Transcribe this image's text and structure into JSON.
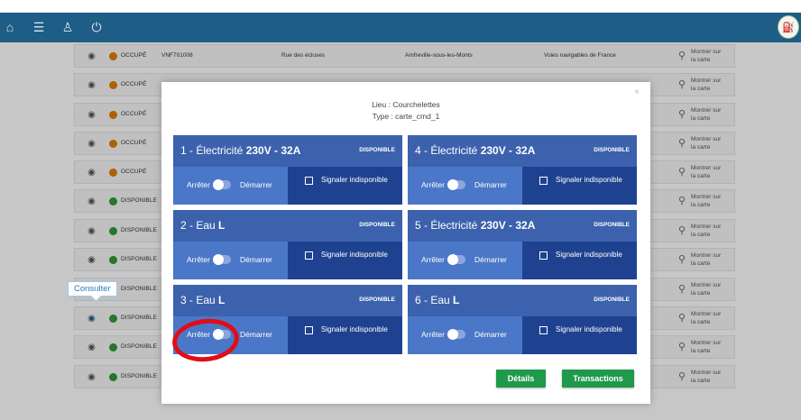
{
  "topbar": {
    "icons": [
      "home-icon",
      "menu-icon",
      "user-icon",
      "power-icon"
    ],
    "logo_icon": "station-logo"
  },
  "background_rows": [
    {
      "status": "OCCUPÉ",
      "status_color": "#e07b00",
      "c1": "VNF701008",
      "c2": "Rue des écluses",
      "c3": "Amfreville-sous-les-Monts",
      "c4": "Voies navigables de France",
      "map": "Montrer sur la carte"
    },
    {
      "status": "OCCUPÉ",
      "status_color": "#e07b00",
      "c1": "",
      "c2": "",
      "c3": "",
      "c4": "",
      "map": "Montrer sur la carte"
    },
    {
      "status": "OCCUPÉ",
      "status_color": "#e07b00",
      "c1": "",
      "c2": "",
      "c3": "",
      "c4": "",
      "map": "Montrer sur la carte"
    },
    {
      "status": "OCCUPÉ",
      "status_color": "#e07b00",
      "c1": "",
      "c2": "",
      "c3": "",
      "c4": "",
      "map": "Montrer sur la carte"
    },
    {
      "status": "OCCUPÉ",
      "status_color": "#e07b00",
      "c1": "",
      "c2": "",
      "c3": "",
      "c4": "",
      "map": "Montrer sur la carte"
    },
    {
      "status": "DISPONIBLE",
      "status_color": "#2e9a3a",
      "c1": "",
      "c2": "",
      "c3": "",
      "c4": "",
      "map": "Montrer sur la carte"
    },
    {
      "status": "DISPONIBLE",
      "status_color": "#2e9a3a",
      "c1": "",
      "c2": "",
      "c3": "",
      "c4": "",
      "map": "Montrer sur la carte"
    },
    {
      "status": "DISPONIBLE",
      "status_color": "#2e9a3a",
      "c1": "",
      "c2": "",
      "c3": "",
      "c4": "",
      "map": "Montrer sur la carte"
    },
    {
      "status": "DISPONIBLE",
      "status_color": "#2e9a3a",
      "c1": "",
      "c2": "",
      "c3": "",
      "c4": "",
      "map": "Montrer sur la carte"
    },
    {
      "status": "DISPONIBLE",
      "status_color": "#2e9a3a",
      "c1": "",
      "c2": "",
      "c3": "",
      "c4": "",
      "map": "Montrer sur la carte"
    },
    {
      "status": "DISPONIBLE",
      "status_color": "#2e9a3a",
      "c1": "",
      "c2": "",
      "c3": "",
      "c4": "",
      "map": "Montrer sur la carte"
    },
    {
      "status": "DISPONIBLE",
      "status_color": "#2e9a3a",
      "c1": "",
      "c2": "",
      "c3": "",
      "c4": "",
      "map": "Montrer sur la carte"
    }
  ],
  "tooltip": "Consulter",
  "modal": {
    "close": "×",
    "lieu": "Lieu : Courchelettes",
    "type": "Type : carte_cmd_1",
    "cards": [
      {
        "prefix": "1 - Électricité ",
        "spec": "230V - 32A",
        "badge": "DISPONIBLE",
        "stop": "Arrêter",
        "start": "Démarrer",
        "report": "Signaler indisponible"
      },
      {
        "prefix": "4 - Électricité ",
        "spec": "230V - 32A",
        "badge": "DISPONIBLE",
        "stop": "Arrêter",
        "start": "Démarrer",
        "report": "Signaler indisponible"
      },
      {
        "prefix": "2 - Eau ",
        "spec": "L",
        "badge": "DISPONIBLE",
        "stop": "Arrêter",
        "start": "Démarrer",
        "report": "Signaler indisponible"
      },
      {
        "prefix": "5 - Électricité ",
        "spec": "230V - 32A",
        "badge": "DISPONIBLE",
        "stop": "Arrêter",
        "start": "Démarrer",
        "report": "Signaler indisponible"
      },
      {
        "prefix": "3 - Eau ",
        "spec": "L",
        "badge": "DISPONIBLE",
        "stop": "Arrêter",
        "start": "Démarrer",
        "report": "Signaler indisponible"
      },
      {
        "prefix": "6 - Eau ",
        "spec": "L",
        "badge": "DISPONIBLE",
        "stop": "Arrêter",
        "start": "Démarrer",
        "report": "Signaler indisponible"
      }
    ],
    "details_label": "Détails",
    "transactions_label": "Transactions"
  },
  "colors": {
    "topbar": "#1e5d85",
    "card_head": "#3c62ad",
    "card_left": "#4b77c8",
    "card_right": "#1f4290",
    "button_green": "#1f9a4a",
    "annotation_red": "#e10d16"
  }
}
